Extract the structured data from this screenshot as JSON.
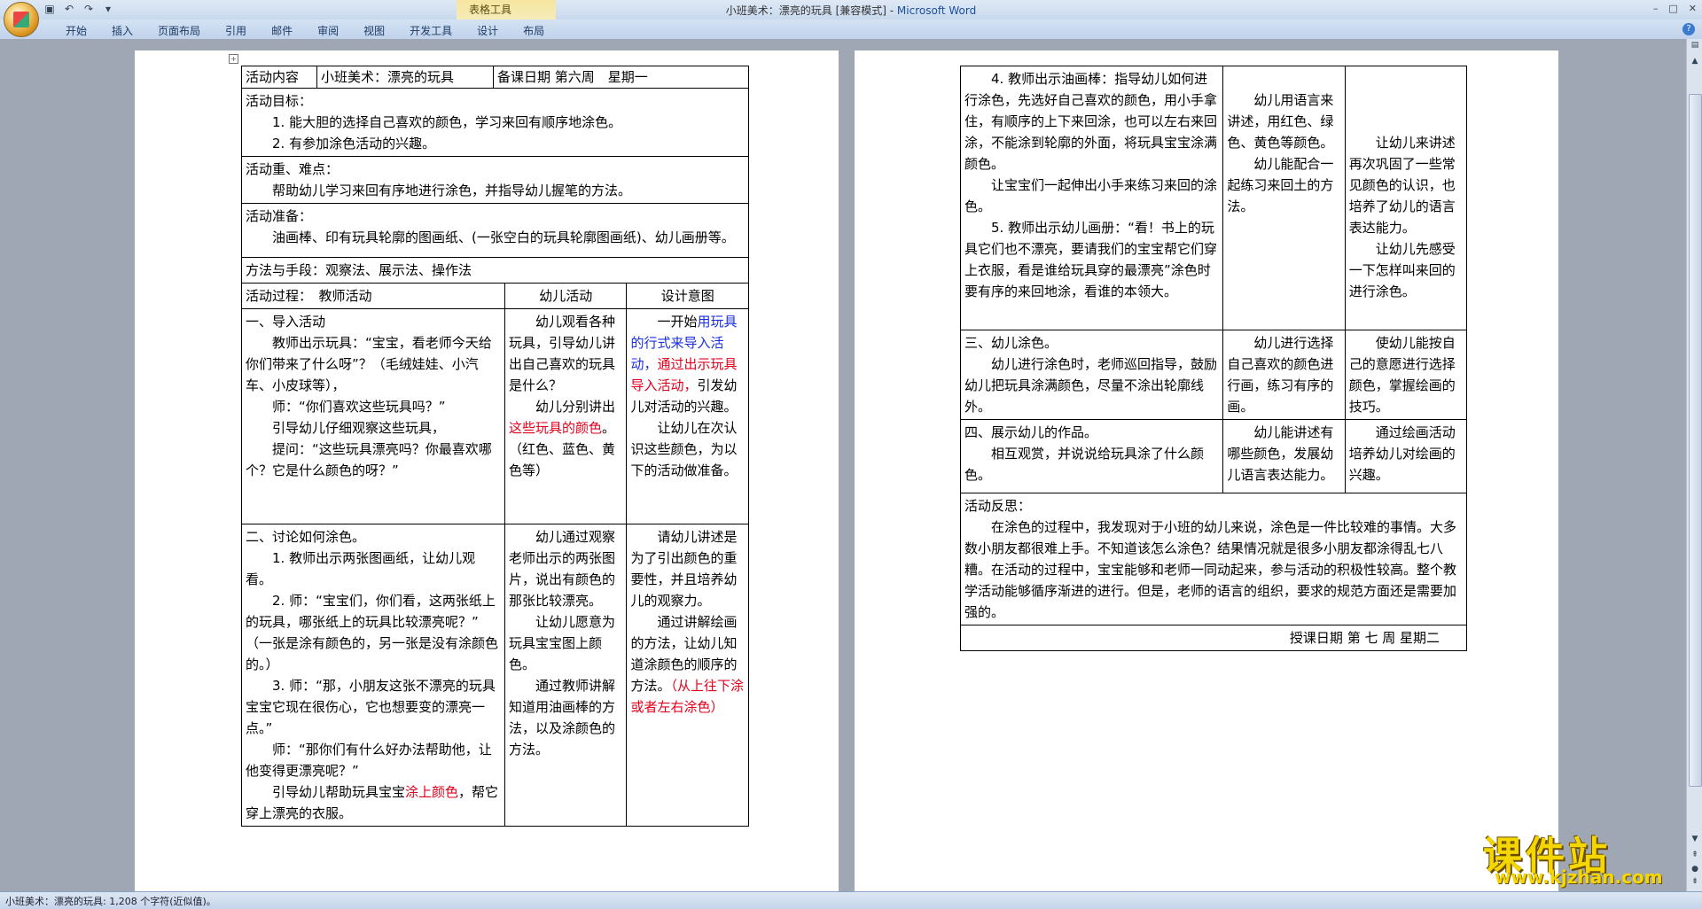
{
  "window": {
    "title_doc": "小班美术：漂亮的玩具 [兼容模式] - ",
    "title_app": "Microsoft Word",
    "context_tab_group": "表格工具"
  },
  "ribbon": {
    "tabs": [
      "开始",
      "插入",
      "页面布局",
      "引用",
      "邮件",
      "审阅",
      "视图",
      "开发工具",
      "设计",
      "布局"
    ]
  },
  "status": {
    "text": "小班美术：漂亮的玩具: 1,208 个字符(近似值)。"
  },
  "page1": {
    "header": {
      "c1": "活动内容",
      "c2": "小班美术：漂亮的玩具",
      "c3": "备课日期 第六周　星期一"
    },
    "goals": {
      "title": "活动目标：",
      "l1": "1. 能大胆的选择自己喜欢的颜色，学习来回有顺序地涂色。",
      "l2": "2. 有参加涂色活动的兴趣。"
    },
    "key": {
      "title": "活动重、难点：",
      "l1": "帮助幼儿学习来回有序地进行涂色，并指导幼儿握笔的方法。"
    },
    "prep": {
      "title": "活动准备：",
      "l1": "油画棒、印有玩具轮廓的图画纸、(一张空白的玩具轮廓图画纸)、幼儿画册等。"
    },
    "method": "方法与手段：观察法、展示法、操作法",
    "cols": {
      "c1": "活动过程：　教师活动",
      "c2": "幼儿活动",
      "c3": "设计意图"
    },
    "s1": {
      "t1": "一、导入活动",
      "t2": "教师出示玩具：“宝宝，看老师今天给你们带来了什么呀”？（毛绒娃娃、小汽车、小皮球等），",
      "t3": "师：“你们喜欢这些玩具吗？”",
      "t4": "引导幼儿仔细观察这些玩具，",
      "t5": "提问：“这些玩具漂亮吗？你最喜欢哪个？它是什么颜色的呀？”",
      "k1": "幼儿观看各种玩具，引导幼儿讲出自己喜欢的玩具是什么？",
      "k2a": "幼儿分别讲出",
      "k2b": "这些玩具的颜色",
      "k2c": "。（红色、蓝色、黄色等）",
      "d1a": "一开始",
      "d1b": "用玩具的行式来导入",
      "d1c": "活动，",
      "d1d": "通过出示玩具导入活动，",
      "d1e": "引发幼儿对活动的兴趣。",
      "d2": "让幼儿在次认识这些颜色，为以下的活动做准备。"
    },
    "s2": {
      "t1": "二、讨论如何涂色。",
      "t2": "1. 教师出示两张图画纸，让幼儿观看。",
      "t3": "2. 师：“宝宝们，你们看，这两张纸上的玩具，哪张纸上的玩具比较漂亮呢？”",
      "t4": "（一张是涂有颜色的，另一张是没有涂颜色的。）",
      "t5": "3. 师：“那，小朋友这张不漂亮的玩具宝宝它现在很伤心，它也想要变的漂亮一点。”",
      "t6": "师：“那你们有什么好办法帮助他，让他变得更漂亮呢？”",
      "t7a": "引导幼儿帮助玩具宝宝",
      "t7b": "涂上颜色",
      "t7c": "，帮它穿上漂亮的衣服。",
      "k1": "幼儿通过观察老师出示的两张图片，说出有颜色的那张比较漂亮。",
      "k2": "让幼儿愿意为玩具宝宝图上颜色。",
      "k3": "通过教师讲解知道用油画棒的方法，以及涂颜色的方法。",
      "d1": "请幼儿讲述是为了引出颜色的重要性，并且培养幼儿的观察力。",
      "d2": "通过讲解绘画的方法，让幼儿知道涂颜色的顺序的方法。",
      "d3": "（从上往下涂或者左右涂色）"
    }
  },
  "page2": {
    "s4": {
      "t1": "4. 教师出示油画棒：指导幼儿如何进行涂色，先选好自己喜欢的颜色，用小手拿住，有顺序的上下来回涂，也可以左右来回涂，不能涂到轮廓的外面，将玩具宝宝涂满颜色。",
      "t2": "让宝宝们一起伸出小手来练习来回的涂色。",
      "t3": "5. 教师出示幼儿画册：“看！书上的玩具它们也不漂亮，要请我们的宝宝帮它们穿上衣服，看是谁给玩具穿的最漂亮”涂色时要有序的来回地涂，看谁的本领大。",
      "k1": "幼儿用语言来讲述，用红色、绿色、黄色等颜色。",
      "k2": "幼儿能配合一起练习来回土的方法。",
      "d1": "让幼儿来讲述再次巩固了一些常见颜色的认识，也培养了幼儿的语言表达能力。",
      "d2": "让幼儿先感受一下怎样叫来回的进行涂色。"
    },
    "s3": {
      "t1": "三、幼儿涂色。",
      "t2": "幼儿进行涂色时，老师巡回指导，鼓励幼儿把玩具涂满颜色，尽量不涂出轮廓线外。",
      "k1": "幼儿进行选择自己喜欢的颜色进行画，练习有序的画。",
      "d1": "使幼儿能按自己的意愿进行选择颜色，掌握绘画的技巧。"
    },
    "s5": {
      "t1": "四、展示幼儿的作品。",
      "t2": "相互观赏，并说说给玩具涂了什么颜色。",
      "k1": "幼儿能讲述有哪些颜色，发展幼儿语言表达能力。",
      "d1": "通过绘画活动培养幼儿对绘画的兴趣。"
    },
    "reflect": {
      "title": "活动反思：",
      "body": "在涂色的过程中，我发现对于小班的幼儿来说，涂色是一件比较难的事情。大多数小朋友都很难上手。不知道该怎么涂色？结果情况就是很多小朋友都涂得乱七八糟。在活动的过程中，宝宝能够和老师一同动起来，参与活动的积极性较高。整个教学活动能够循序渐进的进行。但是，老师的语言的组织，要求的规范方面还是需要加强的。"
    },
    "date": "授课日期 第 七 周 星期二"
  },
  "watermark": {
    "big": "课件站",
    "url": "www.kjzhan.com"
  }
}
